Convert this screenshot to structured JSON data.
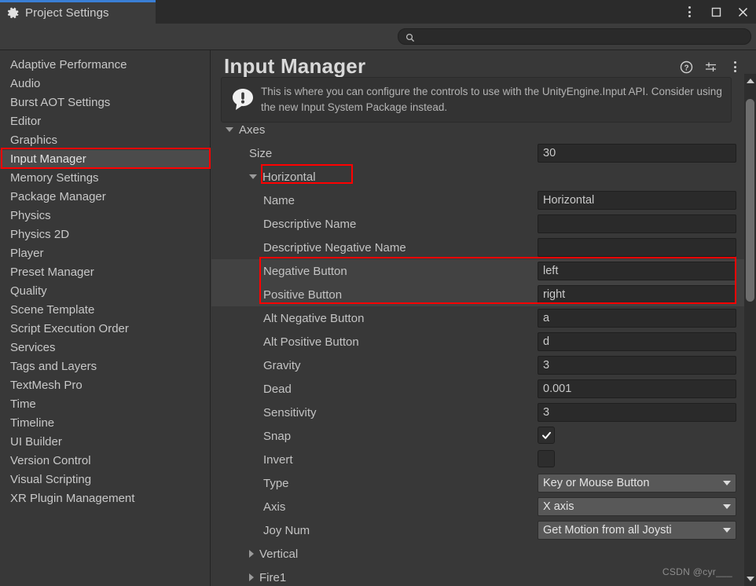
{
  "window": {
    "tab_label": "Project Settings",
    "tab_icon": "gear-icon",
    "controls": {
      "menu": "vertical-dots-icon",
      "maximize": "maximize-icon",
      "close": "close-icon"
    }
  },
  "search": {
    "placeholder": "",
    "value": "",
    "icon": "search-icon"
  },
  "sidebar": {
    "items": [
      {
        "label": "Adaptive Performance",
        "selected": false
      },
      {
        "label": "Audio",
        "selected": false
      },
      {
        "label": "Burst AOT Settings",
        "selected": false
      },
      {
        "label": "Editor",
        "selected": false
      },
      {
        "label": "Graphics",
        "selected": false
      },
      {
        "label": "Input Manager",
        "selected": true
      },
      {
        "label": "Memory Settings",
        "selected": false
      },
      {
        "label": "Package Manager",
        "selected": false
      },
      {
        "label": "Physics",
        "selected": false
      },
      {
        "label": "Physics 2D",
        "selected": false
      },
      {
        "label": "Player",
        "selected": false
      },
      {
        "label": "Preset Manager",
        "selected": false
      },
      {
        "label": "Quality",
        "selected": false
      },
      {
        "label": "Scene Template",
        "selected": false
      },
      {
        "label": "Script Execution Order",
        "selected": false
      },
      {
        "label": "Services",
        "selected": false
      },
      {
        "label": "Tags and Layers",
        "selected": false
      },
      {
        "label": "TextMesh Pro",
        "selected": false
      },
      {
        "label": "Time",
        "selected": false
      },
      {
        "label": "Timeline",
        "selected": false
      },
      {
        "label": "UI Builder",
        "selected": false
      },
      {
        "label": "Version Control",
        "selected": false
      },
      {
        "label": "Visual Scripting",
        "selected": false
      },
      {
        "label": "XR Plugin Management",
        "selected": false
      }
    ]
  },
  "pane": {
    "title": "Input Manager",
    "icons": {
      "help": "help-icon",
      "preset": "preset-sliders-icon",
      "menu": "vertical-dots-icon"
    },
    "help_text": "This is where you can configure the controls to use with the UnityEngine.Input API. Consider using the new Input System Package instead.",
    "help_icon": "info-speech-bubble-icon"
  },
  "properties": {
    "axes_label": "Axes",
    "size_label": "Size",
    "size_value": "30",
    "horizontal_label": "Horizontal",
    "rows": [
      {
        "label": "Name",
        "type": "text",
        "value": "Horizontal",
        "highlight": false
      },
      {
        "label": "Descriptive Name",
        "type": "text",
        "value": "",
        "highlight": false
      },
      {
        "label": "Descriptive Negative Name",
        "type": "text",
        "value": "",
        "highlight": false
      },
      {
        "label": "Negative Button",
        "type": "text",
        "value": "left",
        "highlight": true
      },
      {
        "label": "Positive Button",
        "type": "text",
        "value": "right",
        "highlight": true
      },
      {
        "label": "Alt Negative Button",
        "type": "text",
        "value": "a",
        "highlight": false
      },
      {
        "label": "Alt Positive Button",
        "type": "text",
        "value": "d",
        "highlight": false
      },
      {
        "label": "Gravity",
        "type": "text",
        "value": "3",
        "highlight": false
      },
      {
        "label": "Dead",
        "type": "text",
        "value": "0.001",
        "highlight": false
      },
      {
        "label": "Sensitivity",
        "type": "text",
        "value": "3",
        "highlight": false
      },
      {
        "label": "Snap",
        "type": "check",
        "value": "checked",
        "highlight": false
      },
      {
        "label": "Invert",
        "type": "check",
        "value": "unchecked",
        "highlight": false
      },
      {
        "label": "Type",
        "type": "popup",
        "value": "Key or Mouse Button",
        "highlight": false
      },
      {
        "label": "Axis",
        "type": "popup",
        "value": "X axis",
        "highlight": false
      },
      {
        "label": "Joy Num",
        "type": "popup",
        "value": "Get Motion from all Joysti",
        "highlight": false
      }
    ],
    "collapsed_axes": [
      {
        "label": "Vertical"
      },
      {
        "label": "Fire1"
      }
    ]
  },
  "scrollbar": {
    "up_icon": "scroll-up-arrow-icon",
    "down_icon": "scroll-down-arrow-icon"
  },
  "watermark": "CSDN @cyr___"
}
